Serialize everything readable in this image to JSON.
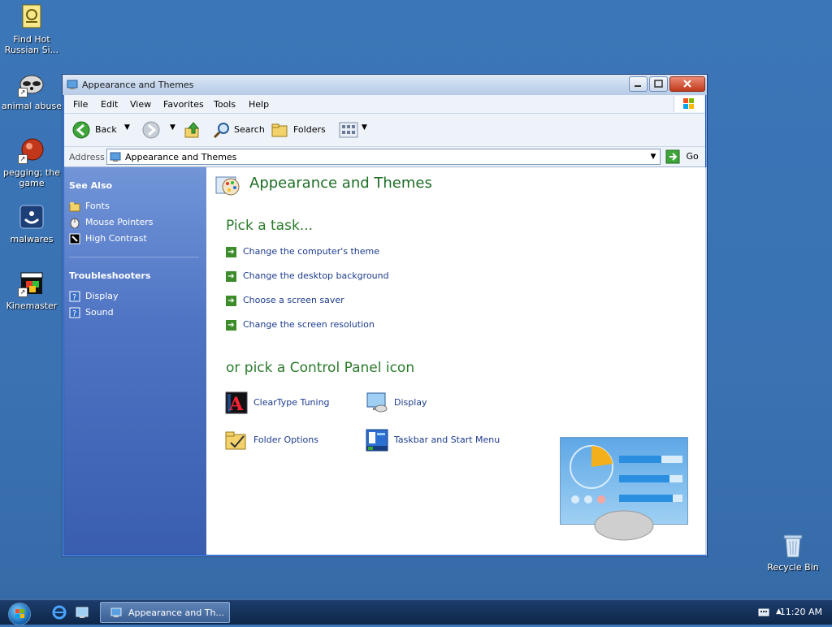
{
  "desktop": {
    "icons": [
      {
        "label": "Find Hot Russian Si..."
      },
      {
        "label": "animal abuse"
      },
      {
        "label": "pegging; the game"
      },
      {
        "label": "malwares"
      },
      {
        "label": "Kinemaster"
      }
    ],
    "recycle_bin": "Recycle Bin"
  },
  "window": {
    "title": "Appearance and Themes",
    "menu": [
      "File",
      "Edit",
      "View",
      "Favorites",
      "Tools",
      "Help"
    ],
    "toolbar": {
      "back": "Back",
      "search": "Search",
      "folders": "Folders"
    },
    "address": {
      "label": "Address",
      "value": "Appearance and Themes",
      "go": "Go"
    },
    "left_pane": {
      "see_also_title": "See Also",
      "see_also": [
        "Fonts",
        "Mouse Pointers",
        "High Contrast"
      ],
      "troubleshooters_title": "Troubleshooters",
      "troubleshooters": [
        "Display",
        "Sound"
      ]
    },
    "content": {
      "title": "Appearance and Themes",
      "pick_task": "Pick a task...",
      "tasks": [
        "Change the computer's theme",
        "Change the desktop background",
        "Choose a screen saver",
        "Change the screen resolution"
      ],
      "pick_icon": "or pick a Control Panel icon",
      "icons": [
        {
          "label": "ClearType Tuning"
        },
        {
          "label": "Display"
        },
        {
          "label": "Folder Options"
        },
        {
          "label": "Taskbar and Start Menu"
        }
      ]
    }
  },
  "taskbar": {
    "active_window": "Appearance and Th...",
    "clock": "11:20 AM"
  },
  "colors": {
    "desktop": "#3a72b2",
    "heading_green": "#2a7a2a",
    "link_blue": "#1c3b8c",
    "sidebar_blue": "#4f74c3"
  }
}
